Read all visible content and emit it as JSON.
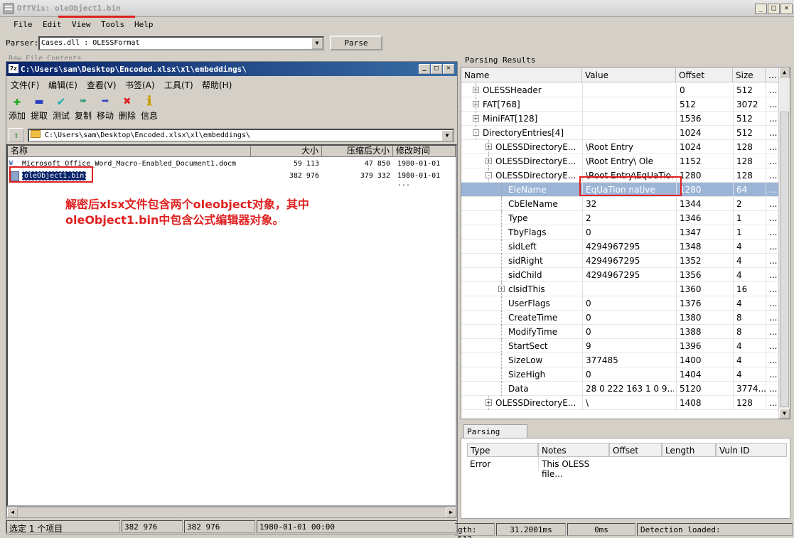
{
  "app": {
    "title": "OffVis: oleObject1.bin",
    "menu": [
      "File",
      "Edit",
      "View",
      "Tools",
      "Help"
    ],
    "window_buttons": [
      "_",
      "□",
      "✕"
    ]
  },
  "parser": {
    "label": "Parser:",
    "value": "Cases.dll : OLESSFormat",
    "button": "Parse"
  },
  "hidden_label": "Raw File Contents",
  "zip": {
    "title": "C:\\Users\\sam\\Desktop\\Encoded.xlsx\\xl\\embeddings\\",
    "menu": [
      "文件(F)",
      "编辑(E)",
      "查看(V)",
      "书签(A)",
      "工具(T)",
      "帮助(H)"
    ],
    "toolbar": [
      {
        "label": "添加",
        "icon": "plus-icon",
        "glyph": "✚",
        "color": "#1faa1f"
      },
      {
        "label": "提取",
        "icon": "minus-icon",
        "glyph": "▬",
        "color": "#2a3fc0"
      },
      {
        "label": "测试",
        "icon": "check-icon",
        "glyph": "✔",
        "color": "#19b0b8"
      },
      {
        "label": "复制",
        "icon": "copy-arrow-icon",
        "glyph": "➠",
        "color": "#2a9a7a"
      },
      {
        "label": "移动",
        "icon": "move-arrow-icon",
        "glyph": "➡",
        "color": "#2a3fc0"
      },
      {
        "label": "删除",
        "icon": "delete-x-icon",
        "glyph": "✖",
        "color": "#e02020"
      },
      {
        "label": "信息",
        "icon": "info-icon",
        "glyph": "ℹ",
        "color": "#c8a000"
      }
    ],
    "path": "C:\\Users\\sam\\Desktop\\Encoded.xlsx\\xl\\embeddings\\",
    "columns": [
      "名称",
      "大小",
      "压缩后大小",
      "修改时间"
    ],
    "files": [
      {
        "name": "Microsoft_Office_Word_Macro-Enabled_Document1.docm",
        "size": "59 113",
        "packed": "47 850",
        "modified": "1980-01-01 ..."
      },
      {
        "name": "oleObject1.bin",
        "size": "382 976",
        "packed": "379 332",
        "modified": "1980-01-01 ..."
      }
    ],
    "status": [
      "选定 1 个项目",
      "382 976",
      "382 976",
      "1980-01-01 00:00"
    ]
  },
  "annotation": {
    "line1": "解密后xlsx文件包含两个oleobject对象，其中",
    "line2": "oleObject1.bin中包含公式编辑器对象。"
  },
  "results": {
    "label": "Parsing Results",
    "columns": [
      "Name",
      "Value",
      "Offset",
      "Size",
      "..."
    ],
    "rows": [
      {
        "indent": 0,
        "exp": "+",
        "name": "OLESSHeader",
        "value": "",
        "offset": "0",
        "size": "512",
        "more": "..."
      },
      {
        "indent": 0,
        "exp": "+",
        "name": "FAT[768]",
        "value": "",
        "offset": "512",
        "size": "3072",
        "more": "..."
      },
      {
        "indent": 0,
        "exp": "+",
        "name": "MiniFAT[128]",
        "value": "",
        "offset": "1536",
        "size": "512",
        "more": "..."
      },
      {
        "indent": 0,
        "exp": "-",
        "name": "DirectoryEntries[4]",
        "value": "",
        "offset": "1024",
        "size": "512",
        "more": "..."
      },
      {
        "indent": 1,
        "exp": "+",
        "name": "OLESSDirectoryE...",
        "value": "\\Root Entry",
        "offset": "1024",
        "size": "128",
        "more": "..."
      },
      {
        "indent": 1,
        "exp": "+",
        "name": "OLESSDirectoryE...",
        "value": "\\Root Entry\\ Ole",
        "offset": "1152",
        "size": "128",
        "more": "..."
      },
      {
        "indent": 1,
        "exp": "-",
        "name": "OLESSDirectoryE...",
        "value": "\\Root Entry\\EqUaTio...",
        "offset": "1280",
        "size": "128",
        "more": "..."
      },
      {
        "indent": 2,
        "exp": "",
        "name": "EleName",
        "value": "EqUaTion native",
        "offset": "1280",
        "size": "64",
        "more": "...",
        "selected": true
      },
      {
        "indent": 2,
        "exp": "",
        "name": "CbEleName",
        "value": "32",
        "offset": "1344",
        "size": "2",
        "more": "..."
      },
      {
        "indent": 2,
        "exp": "",
        "name": "Type",
        "value": "2",
        "offset": "1346",
        "size": "1",
        "more": "..."
      },
      {
        "indent": 2,
        "exp": "",
        "name": "TbyFlags",
        "value": "0",
        "offset": "1347",
        "size": "1",
        "more": "..."
      },
      {
        "indent": 2,
        "exp": "",
        "name": "sidLeft",
        "value": "4294967295",
        "offset": "1348",
        "size": "4",
        "more": "..."
      },
      {
        "indent": 2,
        "exp": "",
        "name": "sidRight",
        "value": "4294967295",
        "offset": "1352",
        "size": "4",
        "more": "..."
      },
      {
        "indent": 2,
        "exp": "",
        "name": "sidChild",
        "value": "4294967295",
        "offset": "1356",
        "size": "4",
        "more": "..."
      },
      {
        "indent": 2,
        "exp": "+",
        "name": "clsidThis",
        "value": "",
        "offset": "1360",
        "size": "16",
        "more": "..."
      },
      {
        "indent": 2,
        "exp": "",
        "name": "UserFlags",
        "value": "0",
        "offset": "1376",
        "size": "4",
        "more": "..."
      },
      {
        "indent": 2,
        "exp": "",
        "name": "CreateTime",
        "value": "0",
        "offset": "1380",
        "size": "8",
        "more": "..."
      },
      {
        "indent": 2,
        "exp": "",
        "name": "ModifyTime",
        "value": "0",
        "offset": "1388",
        "size": "8",
        "more": "..."
      },
      {
        "indent": 2,
        "exp": "",
        "name": "StartSect",
        "value": "9",
        "offset": "1396",
        "size": "4",
        "more": "..."
      },
      {
        "indent": 2,
        "exp": "",
        "name": "SizeLow",
        "value": "377485",
        "offset": "1400",
        "size": "4",
        "more": "..."
      },
      {
        "indent": 2,
        "exp": "",
        "name": "SizeHigh",
        "value": "0",
        "offset": "1404",
        "size": "4",
        "more": "..."
      },
      {
        "indent": 2,
        "exp": "",
        "name": "Data",
        "value": "28 0 222 163 1 0 9...",
        "offset": "5120",
        "size": "3774...",
        "more": "..."
      },
      {
        "indent": 1,
        "exp": "+",
        "name": "OLESSDirectoryE...",
        "value": "\\",
        "offset": "1408",
        "size": "128",
        "more": "..."
      }
    ]
  },
  "notes": {
    "tab": "Parsing Notes",
    "columns": [
      "Type",
      "Notes",
      "Offset",
      "Length",
      "Vuln ID"
    ],
    "rows": [
      {
        "type": "Error",
        "notes": "This OLESS file...",
        "offset": "",
        "length": "",
        "vuln": ""
      }
    ]
  },
  "status_right": [
    "gth: 512",
    "31.2001ms",
    "0ms",
    "Detection loaded:"
  ]
}
